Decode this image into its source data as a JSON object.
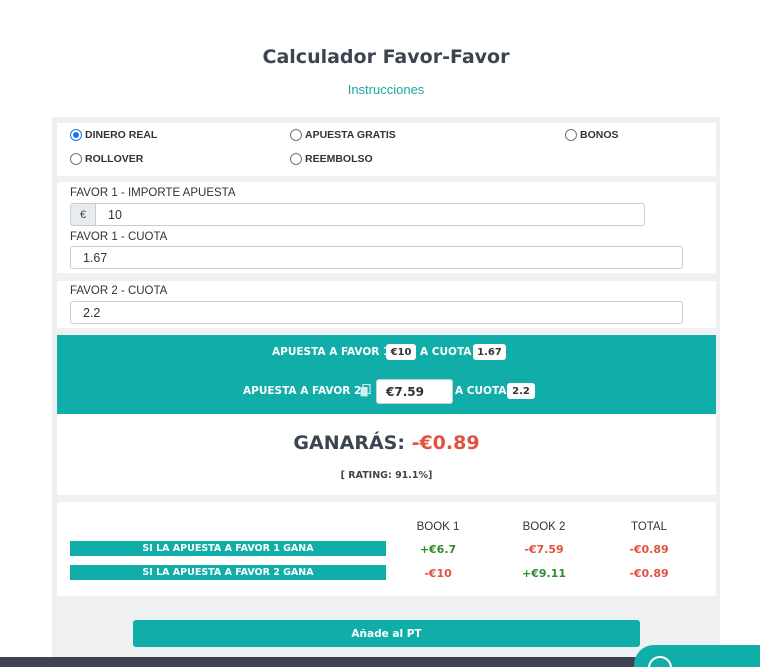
{
  "title": "Calculador Favor-Favor",
  "instructions_link": "Instrucciones",
  "bet_types": {
    "dinero_real": "DINERO REAL",
    "apuesta_gratis": "APUESTA GRATIS",
    "bonos": "BONOS",
    "rollover": "ROLLOVER",
    "reembolso": "REEMBOLSO",
    "selected": "DINERO REAL"
  },
  "favor1": {
    "importe_label": "FAVOR 1 - IMPORTE APUESTA",
    "currency": "€",
    "importe_value": "10",
    "cuota_label": "FAVOR 1 - CUOTA",
    "cuota_value": "1.67"
  },
  "favor2": {
    "cuota_label": "FAVOR 2 - CUOTA",
    "cuota_value": "2.2"
  },
  "summary": {
    "row1_prefix": "APUESTA A FAVOR 1",
    "row1_amount": "€10",
    "row1_mid": "A CUOTA",
    "row1_cuota": "1.67",
    "row2_prefix": "APUESTA A FAVOR 2",
    "row2_amount": "€7.59",
    "row2_mid": "A CUOTA",
    "row2_cuota": "2.2",
    "copy_icon": "copy-icon"
  },
  "result": {
    "label": "GANARÁS:",
    "value": "-€0.89",
    "rating": "[ RATING: 91.1%]"
  },
  "table": {
    "headers": [
      "BOOK 1",
      "BOOK 2",
      "TOTAL"
    ],
    "rows": [
      {
        "label": "SI LA APUESTA A FAVOR 1 GANA",
        "book1": "+€6.7",
        "book2": "-€7.59",
        "total": "-€0.89"
      },
      {
        "label": "SI LA APUESTA A FAVOR 2 GANA",
        "book1": "-€10",
        "book2": "+€9.11",
        "total": "-€0.89"
      }
    ]
  },
  "add_button": "Añade al PT",
  "colors": {
    "accent": "#11aea9",
    "negative": "#e0523f",
    "positive": "#2e8b2e",
    "title": "#3b4451"
  }
}
